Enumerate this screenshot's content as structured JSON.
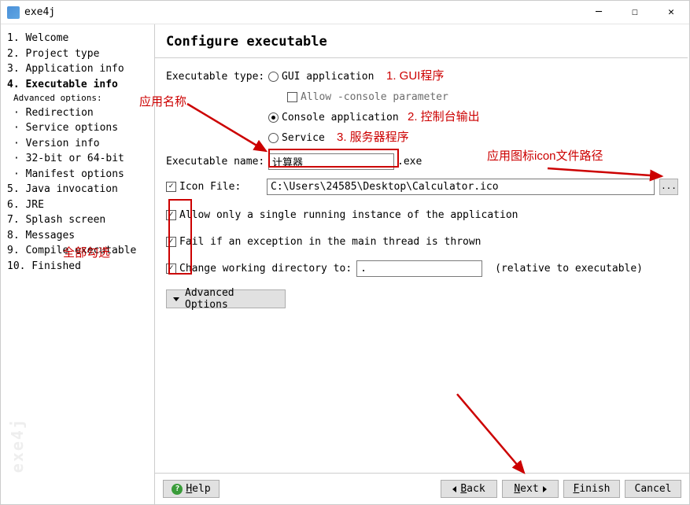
{
  "window": {
    "title": "exe4j"
  },
  "sidebar": {
    "watermark": "exe4j",
    "steps": [
      "1. Welcome",
      "2. Project type",
      "3. Application info",
      "4. Executable info"
    ],
    "active_index": 3,
    "adv_header": "Advanced options:",
    "adv_items": [
      "· Redirection",
      "· Service options",
      "· Version info",
      "· 32-bit or 64-bit",
      "· Manifest options"
    ],
    "steps_after": [
      "5. Java invocation",
      "6. JRE",
      "7. Splash screen",
      "8. Messages",
      "9. Compile executable",
      "10. Finished"
    ]
  },
  "header": {
    "title": "Configure executable"
  },
  "form": {
    "exec_type_label": "Executable type:",
    "gui_radio": "GUI application",
    "allow_console_check": "Allow -console parameter",
    "console_radio": "Console application",
    "service_radio": "Service",
    "exec_name_label": "Executable name:",
    "exec_name_value": "计算器",
    "exe_suffix": ".exe",
    "icon_file_check": "Icon File:",
    "icon_file_value": "C:\\Users\\24585\\Desktop\\Calculator.ico",
    "browse_label": "...",
    "single_instance": "Allow only a single running instance of the application",
    "fail_exception": "Fail if an exception in the main thread is thrown",
    "change_dir": "Change working directory to:",
    "working_dir_value": ".",
    "relative_text": "(relative to executable)",
    "adv_options_btn": "Advanced Options"
  },
  "footer": {
    "help": "Help",
    "back": "Back",
    "next": "Next",
    "finish": "Finish",
    "cancel": "Cancel"
  },
  "annotations": {
    "app_name": "应用名称",
    "gui_hint": "1. GUI程序",
    "console_hint": "2. 控制台输出",
    "service_hint": "3. 服务器程序",
    "icon_path_hint": "应用图标icon文件路径",
    "check_all": "全部勾选"
  }
}
